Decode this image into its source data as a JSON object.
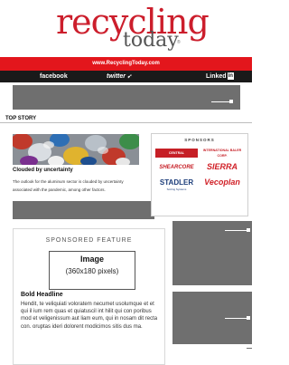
{
  "header": {
    "logo_main": "recycling",
    "logo_sub": "today",
    "logo_trademark": "®"
  },
  "red_bar": {
    "url": "www.RecyclingToday.com"
  },
  "social": {
    "facebook": "facebook",
    "twitter": "twitter",
    "linkedin": "Linked",
    "linkedin_mark": "in"
  },
  "section": {
    "label": "TOP STORY"
  },
  "story": {
    "title": "Clouded by uncertainty",
    "summary": "The outlook for the aluminum sector is clouded by uncertainty associated with the pandemic, among other factors."
  },
  "sponsors": {
    "title": "SPONSORS",
    "items": [
      "CENTRAL MANUFACTURING",
      "INTERNATIONAL BALER CORP.",
      "SHEARCORE",
      "SIERRA",
      "STADLER",
      "Vecoplan"
    ],
    "stadler_tagline": "Sorting Systems"
  },
  "feature": {
    "label": "SPONSORED FEATURE",
    "image_title": "Image",
    "image_size": "(360x180 pixels)",
    "headline": "Bold Headline",
    "body": "Hendit, te veliquiati voloratem necumet usolumque et et qui il ium rem quas et quiatuscil int hilit qui con poribus mod et veligenissum aut liam eum, qui in nosam dit recta con. oruptas ideri dolorent modicimos sitis dus ma."
  },
  "colors": {
    "brand_red": "#e3161c",
    "dark_bar": "#1a1a1a",
    "placeholder_grey": "#6f6f6f"
  }
}
